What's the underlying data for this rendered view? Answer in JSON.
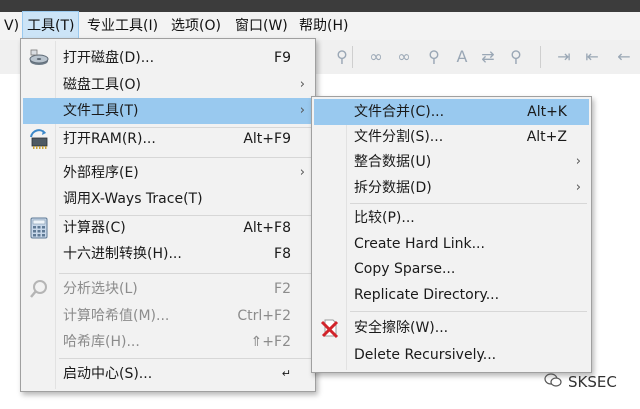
{
  "menubar": {
    "items": [
      "V)",
      "工具(T)",
      "专业工具(I)",
      "选项(O)",
      "窗口(W)",
      "帮助(H)"
    ]
  },
  "tools_menu": {
    "items": [
      {
        "label": "打开磁盘(D)...",
        "shortcut": "F9",
        "icon": "disk-icon"
      },
      {
        "label": "磁盘工具(O)",
        "submenu": true
      },
      {
        "label": "文件工具(T)",
        "submenu": true,
        "highlighted": true
      },
      {
        "label": "打开RAM(R)...",
        "shortcut": "Alt+F9",
        "icon": "ram-chip-icon"
      },
      {
        "label": "外部程序(E)",
        "submenu": true
      },
      {
        "label": "调用X-Ways Trace(T)"
      },
      {
        "label": "计算器(C)",
        "shortcut": "Alt+F8",
        "icon": "calculator-icon"
      },
      {
        "label": "十六进制转换(H)...",
        "shortcut": "F8"
      },
      {
        "label": "分析选块(L)",
        "shortcut": "F2",
        "disabled": true,
        "icon": "magnifier-icon"
      },
      {
        "label": "计算哈希值(M)...",
        "shortcut": "Ctrl+F2",
        "disabled": true
      },
      {
        "label": "哈希库(H)...",
        "shortcut": "⇑+F2",
        "disabled": true
      },
      {
        "label": "启动中心(S)...",
        "shortcut": "↵"
      }
    ]
  },
  "file_tools_submenu": {
    "items": [
      {
        "label": "文件合并(C)...",
        "shortcut": "Alt+K",
        "highlighted": true
      },
      {
        "label": "文件分割(S)...",
        "shortcut": "Alt+Z"
      },
      {
        "label": "整合数据(U)",
        "submenu": true
      },
      {
        "label": "拆分数据(D)",
        "submenu": true
      },
      {
        "label": "比较(P)..."
      },
      {
        "label": "Create Hard Link..."
      },
      {
        "label": "Copy Sparse..."
      },
      {
        "label": "Replicate Directory..."
      },
      {
        "label": "安全擦除(W)...",
        "icon": "secure-erase-icon"
      },
      {
        "label": "Delete Recursively..."
      }
    ]
  },
  "watermark": {
    "text": "SKSEC"
  },
  "colors": {
    "highlight": "#99c9ef",
    "menu_bg": "#f2f2f2",
    "disabled_text": "#8c8c8c"
  }
}
